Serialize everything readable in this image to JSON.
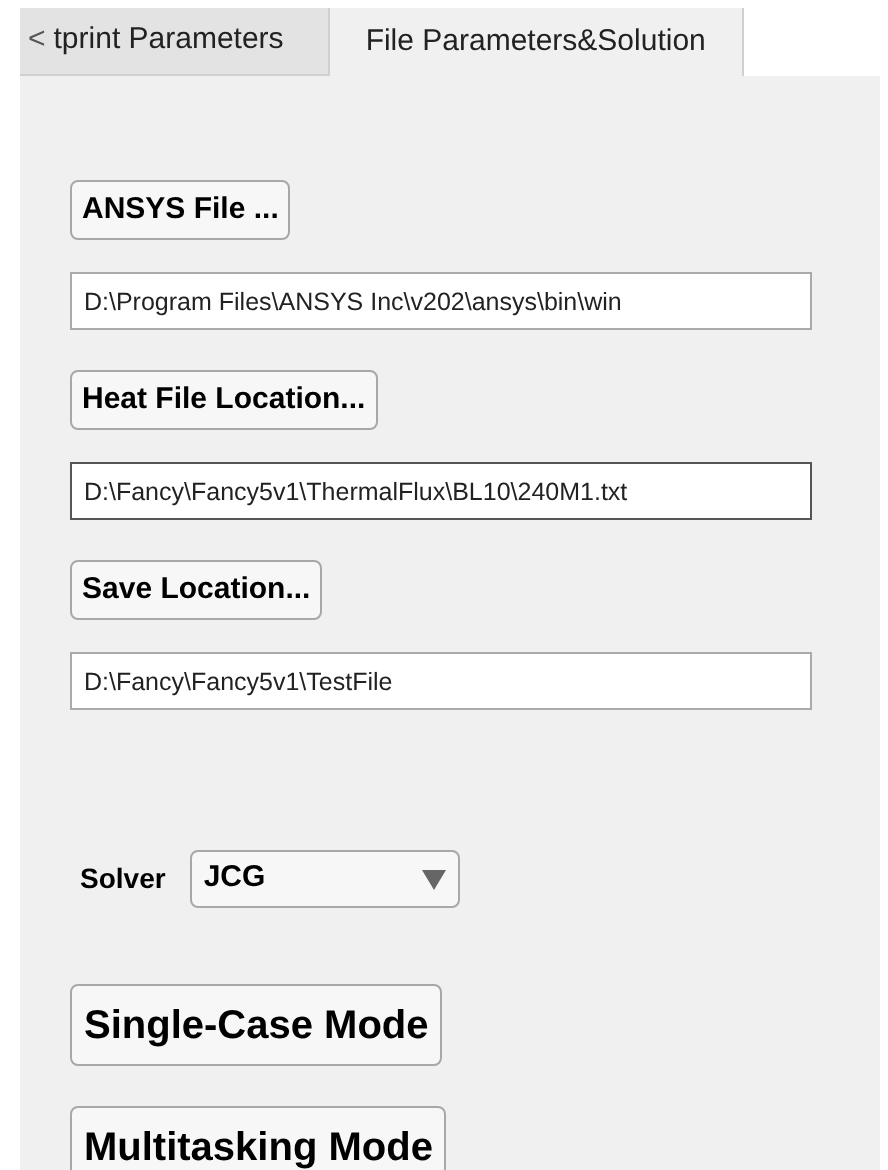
{
  "tab_scroll": "<",
  "tabs": [
    {
      "label": "tprint Parameters",
      "selected": false
    },
    {
      "label": "File Parameters&Solution",
      "selected": true
    }
  ],
  "file_rows": [
    {
      "button": "ANSYS File ...",
      "value": "D:\\Program Files\\ANSYS Inc\\v202\\ansys\\bin\\win",
      "focused": false
    },
    {
      "button": "Heat File Location...",
      "value": "D:\\Fancy\\Fancy5v1\\ThermalFlux\\BL10\\240M1.txt",
      "focused": true
    },
    {
      "button": "Save Location...",
      "value": "D:\\Fancy\\Fancy5v1\\TestFile",
      "focused": false
    }
  ],
  "solver": {
    "label": "Solver",
    "value": "JCG"
  },
  "mode_buttons": [
    "Single-Case Mode",
    "Multitasking Mode"
  ]
}
